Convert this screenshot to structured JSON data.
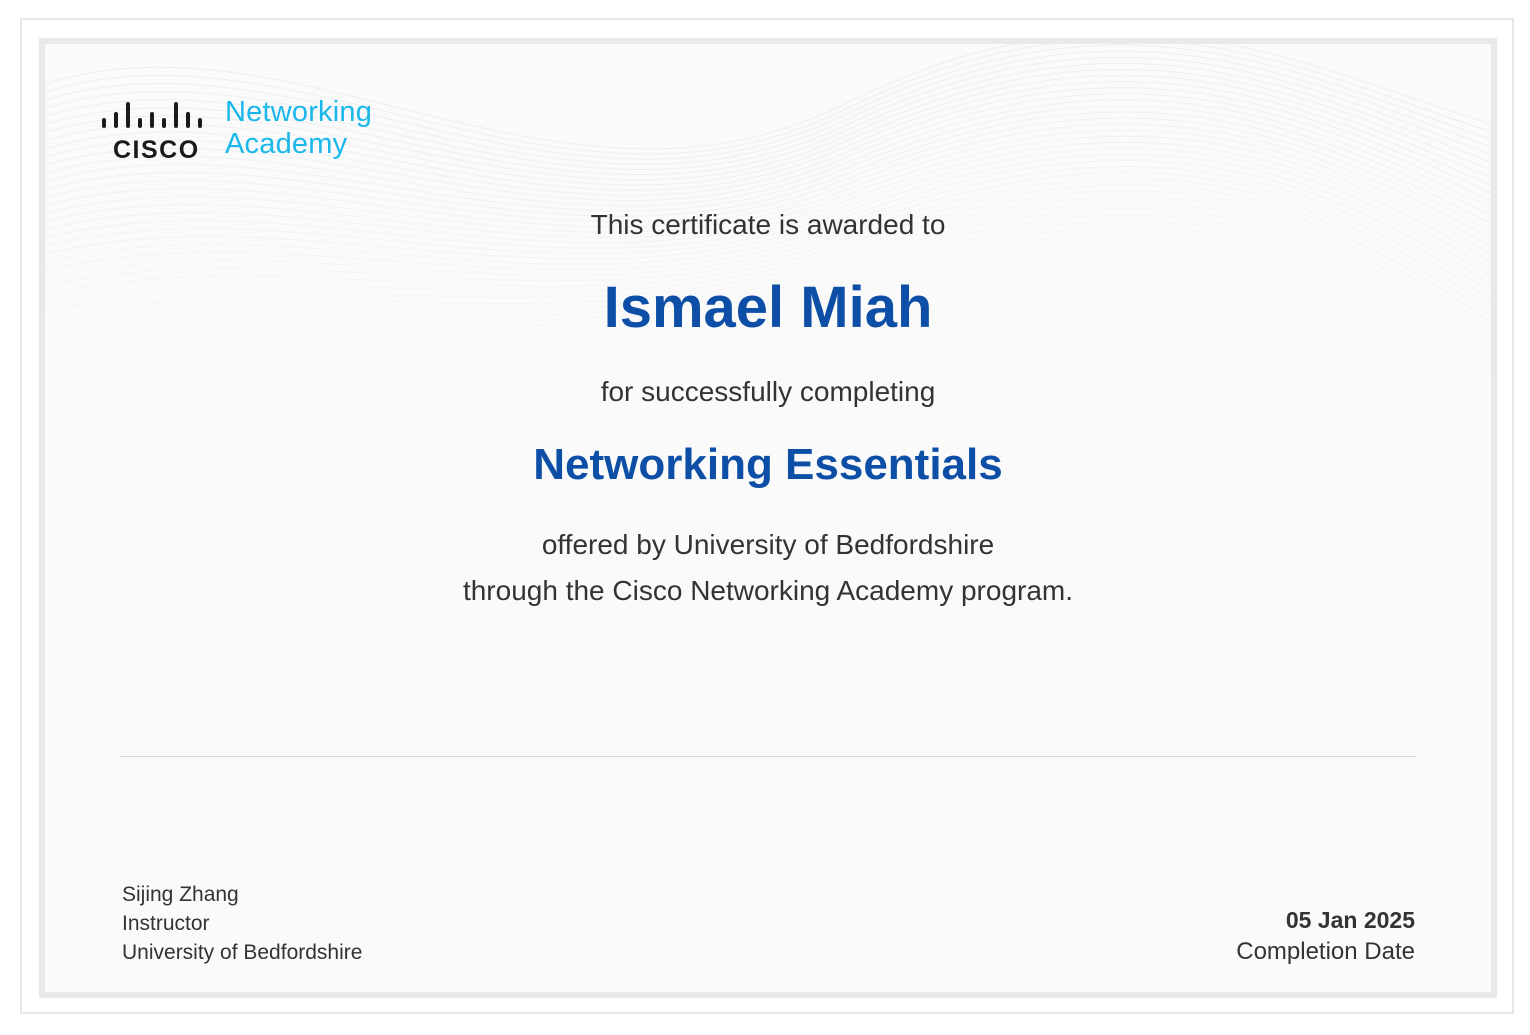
{
  "logo": {
    "wordmark": "CISCO",
    "line1": "Networking",
    "line2": "Academy",
    "icon": "cisco-bridge-icon"
  },
  "certificate": {
    "intro": "This certificate is awarded to",
    "recipient": "Ismael Miah",
    "completion_text": "for successfully completing",
    "course": "Networking Essentials",
    "offered_line1": "offered by University of Bedfordshire",
    "offered_line2": "through the Cisco Networking Academy program."
  },
  "signer": {
    "name": "Sijing Zhang",
    "role": "Instructor",
    "institution": "University of Bedfordshire"
  },
  "completion": {
    "date": "05 Jan 2025",
    "label": "Completion Date"
  },
  "colors": {
    "accent_blue": "#0d4ea6",
    "logo_cyan": "#1ab7ea",
    "text": "#333333"
  }
}
